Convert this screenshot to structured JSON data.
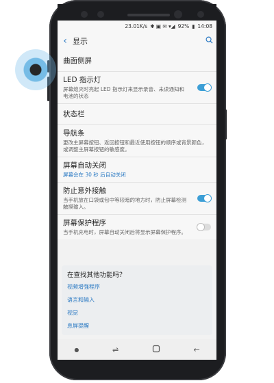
{
  "status": {
    "speed": "23.01K/s",
    "icons": "✱ ▣ ✉ ▾◢",
    "battery": "92%",
    "time": "14:08"
  },
  "appbar": {
    "back_icon": "chevron-left-icon",
    "title": "显示",
    "search_icon": "search-icon"
  },
  "items": [
    {
      "title": "曲面侧屏",
      "desc": ""
    },
    {
      "title": "LED 指示灯",
      "desc": "屏幕熄灭时亮起 LED 指示灯来显示录音、未读通知和电池的状态",
      "toggle": true
    },
    {
      "title": "状态栏",
      "desc": ""
    },
    {
      "title": "导航条",
      "desc": "更改主屏幕按钮、返回按钮和最近使用按钮的顺序或背景颜色，或调整主屏幕按钮的敏感度。"
    },
    {
      "title": "屏幕自动关闭",
      "desc": "屏幕会在 30 秒 后自动关闭",
      "desc_color": "blue"
    },
    {
      "title": "防止意外接触",
      "desc": "当手机放在口袋或包中等较暗的地方时，防止屏幕检测触摸输入。",
      "toggle": true
    },
    {
      "title": "屏幕保护程序",
      "desc": "当手机充电时，屏幕自动关闭后将显示屏幕保护程序。",
      "toggle": false
    }
  ],
  "card": {
    "question": "在查找其他功能吗？",
    "links": [
      "视频增强程序",
      "语言和输入",
      "视觉",
      "息屏提醒"
    ]
  },
  "navbar": {
    "dot_icon": "dot-icon",
    "recent_icon": "recent-apps-icon",
    "home_icon": "home-icon",
    "back_icon": "back-arrow-icon"
  },
  "colors": {
    "accent": "#2a79c3",
    "toggle_on": "#3d9fd6"
  }
}
